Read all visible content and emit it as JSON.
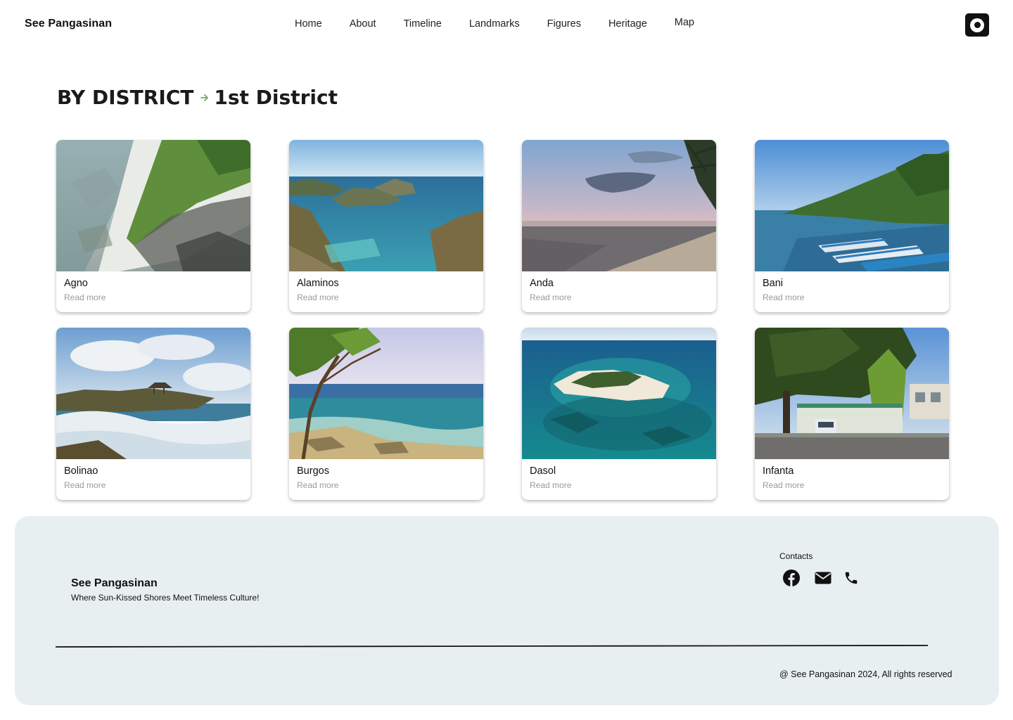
{
  "header": {
    "brand": "See Pangasinan",
    "nav": [
      "Home",
      "About",
      "Timeline",
      "Landmarks",
      "Figures",
      "Heritage",
      "Map"
    ]
  },
  "title": {
    "section": "BY DISTRICT",
    "current": "1st District"
  },
  "cards": [
    {
      "name": "Agno",
      "link": "Read more"
    },
    {
      "name": "Alaminos",
      "link": "Read more"
    },
    {
      "name": "Anda",
      "link": "Read more"
    },
    {
      "name": "Bani",
      "link": "Read more"
    },
    {
      "name": "Bolinao",
      "link": "Read more"
    },
    {
      "name": "Burgos",
      "link": "Read more"
    },
    {
      "name": "Dasol",
      "link": "Read more"
    },
    {
      "name": "Infanta",
      "link": "Read more"
    }
  ],
  "footer": {
    "brand": "See Pangasinan",
    "tagline": "Where Sun-Kissed Shores Meet Timeless Culture!",
    "contacts_label": "Contacts",
    "contact_icons": [
      "facebook-icon",
      "email-icon",
      "phone-icon"
    ],
    "copyright": "@ See Pangasinan 2024, All rights reserved"
  },
  "colors": {
    "footer_bg": "#e8eff1",
    "arrow_accent": "#7da36a",
    "text_dark": "#111111",
    "read_more": "#9a9a9a"
  }
}
